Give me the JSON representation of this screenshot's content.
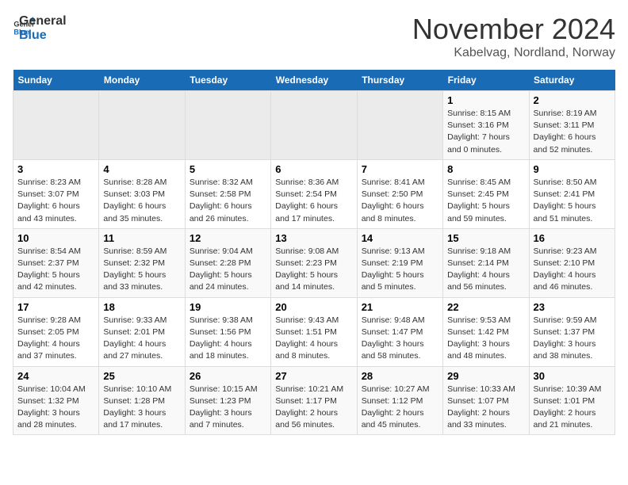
{
  "logo": {
    "line1": "General",
    "line2": "Blue"
  },
  "title": "November 2024",
  "subtitle": "Kabelvag, Nordland, Norway",
  "weekdays": [
    "Sunday",
    "Monday",
    "Tuesday",
    "Wednesday",
    "Thursday",
    "Friday",
    "Saturday"
  ],
  "weeks": [
    [
      {
        "day": "",
        "info": ""
      },
      {
        "day": "",
        "info": ""
      },
      {
        "day": "",
        "info": ""
      },
      {
        "day": "",
        "info": ""
      },
      {
        "day": "",
        "info": ""
      },
      {
        "day": "1",
        "info": "Sunrise: 8:15 AM\nSunset: 3:16 PM\nDaylight: 7 hours\nand 0 minutes."
      },
      {
        "day": "2",
        "info": "Sunrise: 8:19 AM\nSunset: 3:11 PM\nDaylight: 6 hours\nand 52 minutes."
      }
    ],
    [
      {
        "day": "3",
        "info": "Sunrise: 8:23 AM\nSunset: 3:07 PM\nDaylight: 6 hours\nand 43 minutes."
      },
      {
        "day": "4",
        "info": "Sunrise: 8:28 AM\nSunset: 3:03 PM\nDaylight: 6 hours\nand 35 minutes."
      },
      {
        "day": "5",
        "info": "Sunrise: 8:32 AM\nSunset: 2:58 PM\nDaylight: 6 hours\nand 26 minutes."
      },
      {
        "day": "6",
        "info": "Sunrise: 8:36 AM\nSunset: 2:54 PM\nDaylight: 6 hours\nand 17 minutes."
      },
      {
        "day": "7",
        "info": "Sunrise: 8:41 AM\nSunset: 2:50 PM\nDaylight: 6 hours\nand 8 minutes."
      },
      {
        "day": "8",
        "info": "Sunrise: 8:45 AM\nSunset: 2:45 PM\nDaylight: 5 hours\nand 59 minutes."
      },
      {
        "day": "9",
        "info": "Sunrise: 8:50 AM\nSunset: 2:41 PM\nDaylight: 5 hours\nand 51 minutes."
      }
    ],
    [
      {
        "day": "10",
        "info": "Sunrise: 8:54 AM\nSunset: 2:37 PM\nDaylight: 5 hours\nand 42 minutes."
      },
      {
        "day": "11",
        "info": "Sunrise: 8:59 AM\nSunset: 2:32 PM\nDaylight: 5 hours\nand 33 minutes."
      },
      {
        "day": "12",
        "info": "Sunrise: 9:04 AM\nSunset: 2:28 PM\nDaylight: 5 hours\nand 24 minutes."
      },
      {
        "day": "13",
        "info": "Sunrise: 9:08 AM\nSunset: 2:23 PM\nDaylight: 5 hours\nand 14 minutes."
      },
      {
        "day": "14",
        "info": "Sunrise: 9:13 AM\nSunset: 2:19 PM\nDaylight: 5 hours\nand 5 minutes."
      },
      {
        "day": "15",
        "info": "Sunrise: 9:18 AM\nSunset: 2:14 PM\nDaylight: 4 hours\nand 56 minutes."
      },
      {
        "day": "16",
        "info": "Sunrise: 9:23 AM\nSunset: 2:10 PM\nDaylight: 4 hours\nand 46 minutes."
      }
    ],
    [
      {
        "day": "17",
        "info": "Sunrise: 9:28 AM\nSunset: 2:05 PM\nDaylight: 4 hours\nand 37 minutes."
      },
      {
        "day": "18",
        "info": "Sunrise: 9:33 AM\nSunset: 2:01 PM\nDaylight: 4 hours\nand 27 minutes."
      },
      {
        "day": "19",
        "info": "Sunrise: 9:38 AM\nSunset: 1:56 PM\nDaylight: 4 hours\nand 18 minutes."
      },
      {
        "day": "20",
        "info": "Sunrise: 9:43 AM\nSunset: 1:51 PM\nDaylight: 4 hours\nand 8 minutes."
      },
      {
        "day": "21",
        "info": "Sunrise: 9:48 AM\nSunset: 1:47 PM\nDaylight: 3 hours\nand 58 minutes."
      },
      {
        "day": "22",
        "info": "Sunrise: 9:53 AM\nSunset: 1:42 PM\nDaylight: 3 hours\nand 48 minutes."
      },
      {
        "day": "23",
        "info": "Sunrise: 9:59 AM\nSunset: 1:37 PM\nDaylight: 3 hours\nand 38 minutes."
      }
    ],
    [
      {
        "day": "24",
        "info": "Sunrise: 10:04 AM\nSunset: 1:32 PM\nDaylight: 3 hours\nand 28 minutes."
      },
      {
        "day": "25",
        "info": "Sunrise: 10:10 AM\nSunset: 1:28 PM\nDaylight: 3 hours\nand 17 minutes."
      },
      {
        "day": "26",
        "info": "Sunrise: 10:15 AM\nSunset: 1:23 PM\nDaylight: 3 hours\nand 7 minutes."
      },
      {
        "day": "27",
        "info": "Sunrise: 10:21 AM\nSunset: 1:17 PM\nDaylight: 2 hours\nand 56 minutes."
      },
      {
        "day": "28",
        "info": "Sunrise: 10:27 AM\nSunset: 1:12 PM\nDaylight: 2 hours\nand 45 minutes."
      },
      {
        "day": "29",
        "info": "Sunrise: 10:33 AM\nSunset: 1:07 PM\nDaylight: 2 hours\nand 33 minutes."
      },
      {
        "day": "30",
        "info": "Sunrise: 10:39 AM\nSunset: 1:01 PM\nDaylight: 2 hours\nand 21 minutes."
      }
    ]
  ]
}
